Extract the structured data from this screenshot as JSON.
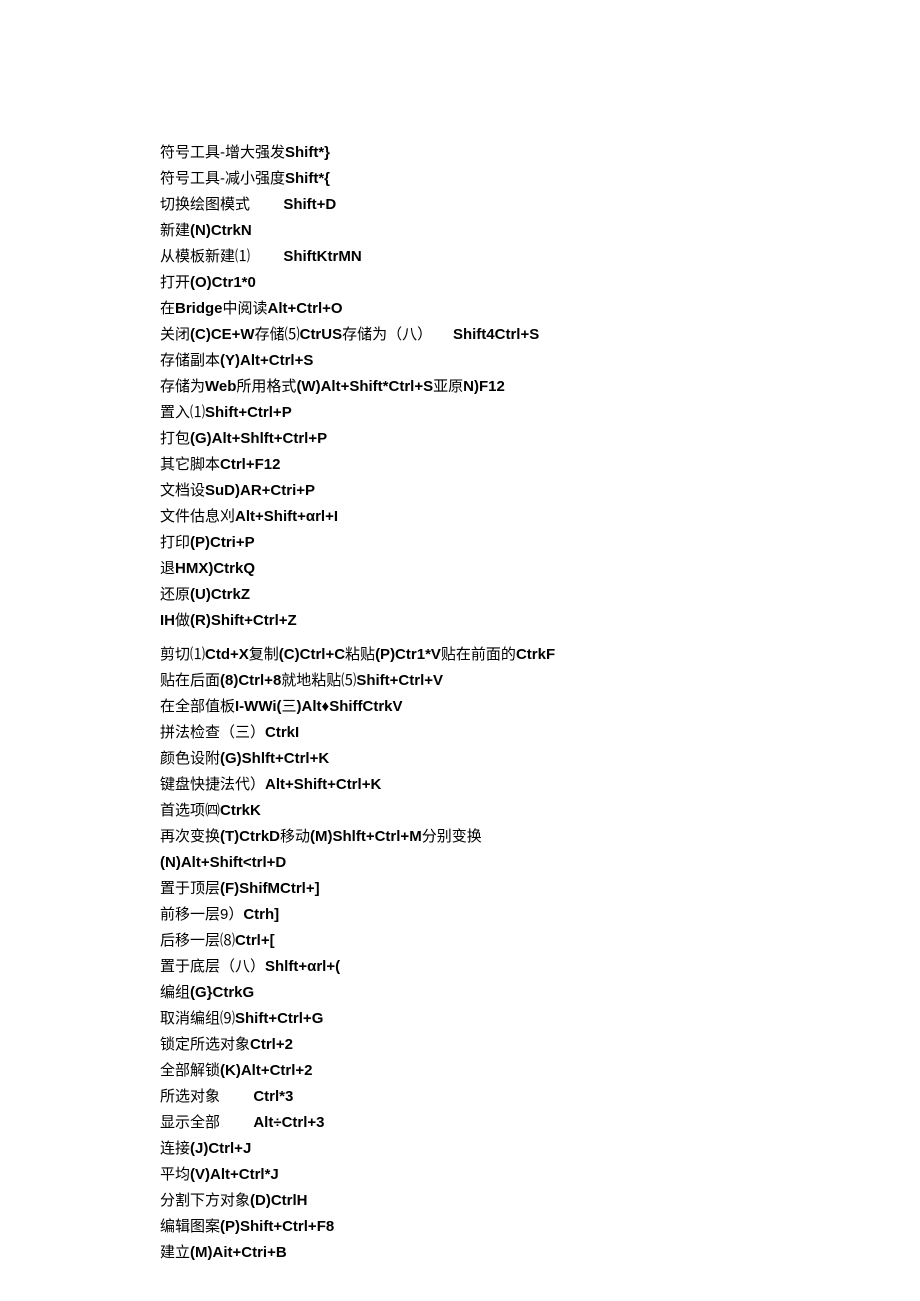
{
  "lines": [
    [
      {
        "t": "cn",
        "v": "符号工具-增大强发"
      },
      {
        "t": "en",
        "v": "Shift*}"
      }
    ],
    [
      {
        "t": "cn",
        "v": "符号工具-减小强度"
      },
      {
        "t": "en",
        "v": "Shift*{"
      }
    ],
    [
      {
        "t": "cn",
        "v": "切换绘图模式        "
      },
      {
        "t": "en",
        "v": "Shift+D"
      }
    ],
    [
      {
        "t": "cn",
        "v": "新建"
      },
      {
        "t": "en",
        "v": "(N)CtrkN"
      }
    ],
    [
      {
        "t": "cn",
        "v": "从模板新建⑴        "
      },
      {
        "t": "en",
        "v": "ShiftKtrMN"
      }
    ],
    [
      {
        "t": "cn",
        "v": "打开"
      },
      {
        "t": "en",
        "v": "(O)Ctr1*0"
      }
    ],
    [
      {
        "t": "cn",
        "v": "在"
      },
      {
        "t": "en",
        "v": "Bridge"
      },
      {
        "t": "cn",
        "v": "中阅读"
      },
      {
        "t": "en",
        "v": "Alt+Ctrl+O"
      }
    ],
    [
      {
        "t": "cn",
        "v": "关闭"
      },
      {
        "t": "en",
        "v": "(C)CE+W"
      },
      {
        "t": "cn",
        "v": "存储⑸"
      },
      {
        "t": "en",
        "v": "CtrUS"
      },
      {
        "t": "cn",
        "v": "存储为（八）     "
      },
      {
        "t": "en",
        "v": "Shift4Ctrl+S"
      }
    ],
    [
      {
        "t": "cn",
        "v": "存储副本"
      },
      {
        "t": "en",
        "v": "(Y)Alt+Ctrl+S"
      }
    ],
    [
      {
        "t": "cn",
        "v": "存储为"
      },
      {
        "t": "en",
        "v": "Web"
      },
      {
        "t": "cn",
        "v": "所用格式"
      },
      {
        "t": "en",
        "v": "(W)Alt+Shift*Ctrl+S"
      },
      {
        "t": "cn",
        "v": "亚原"
      },
      {
        "t": "en",
        "v": "N)F12"
      }
    ],
    [
      {
        "t": "cn",
        "v": "置入⑴"
      },
      {
        "t": "en",
        "v": "Shift+Ctrl+P"
      }
    ],
    [
      {
        "t": "cn",
        "v": "打包"
      },
      {
        "t": "en",
        "v": "(G)Alt+Shlft+Ctrl+P"
      }
    ],
    [
      {
        "t": "cn",
        "v": "其它脚本"
      },
      {
        "t": "en",
        "v": "Ctrl+F12"
      }
    ],
    [
      {
        "t": "cn",
        "v": "文档设"
      },
      {
        "t": "en",
        "v": "SuD)AR+Ctri+P"
      }
    ],
    [
      {
        "t": "cn",
        "v": "文件估息刈"
      },
      {
        "t": "en",
        "v": "Alt+Shift+αrl+I"
      }
    ],
    [
      {
        "t": "cn",
        "v": "打印"
      },
      {
        "t": "en",
        "v": "(P)Ctri+P"
      }
    ],
    [
      {
        "t": "cn",
        "v": "退"
      },
      {
        "t": "en",
        "v": "HMX)CtrkQ"
      }
    ],
    [
      {
        "t": "cn",
        "v": "还原"
      },
      {
        "t": "en",
        "v": "(U)CtrkZ"
      }
    ],
    [
      {
        "t": "en",
        "v": "IH"
      },
      {
        "t": "cn",
        "v": "做"
      },
      {
        "t": "en",
        "v": "(R)Shift+Ctrl+Z"
      }
    ],
    [
      {
        "t": "sp",
        "v": ""
      }
    ],
    [
      {
        "t": "cn",
        "v": "剪切⑴"
      },
      {
        "t": "en",
        "v": "Ctd+X"
      },
      {
        "t": "cn",
        "v": "复制"
      },
      {
        "t": "en",
        "v": "(C)Ctrl+C"
      },
      {
        "t": "cn",
        "v": "粘贴"
      },
      {
        "t": "en",
        "v": "(P)Ctr1*V"
      },
      {
        "t": "cn",
        "v": "贴在前面的"
      },
      {
        "t": "en",
        "v": "CtrkF"
      }
    ],
    [
      {
        "t": "cn",
        "v": "贴在后面"
      },
      {
        "t": "en",
        "v": "(8)Ctrl+8"
      },
      {
        "t": "cn",
        "v": "就地粘贴⑸"
      },
      {
        "t": "en",
        "v": "Shift+Ctrl+V"
      }
    ],
    [
      {
        "t": "cn",
        "v": "在全部值板"
      },
      {
        "t": "en",
        "v": "I-WWi("
      },
      {
        "t": "cn",
        "v": "三"
      },
      {
        "t": "en",
        "v": ")Alt♦ShiffCtrkV"
      }
    ],
    [
      {
        "t": "cn",
        "v": "拼法检查（三）"
      },
      {
        "t": "en",
        "v": "CtrkI"
      }
    ],
    [
      {
        "t": "cn",
        "v": "颜色设附"
      },
      {
        "t": "en",
        "v": "(G)Shlft+Ctrl+K"
      }
    ],
    [
      {
        "t": "cn",
        "v": "键盘快捷法代）"
      },
      {
        "t": "en",
        "v": "Alt+Shift+Ctrl+K"
      }
    ],
    [
      {
        "t": "cn",
        "v": "首选项㈣"
      },
      {
        "t": "en",
        "v": "CtrkK"
      }
    ],
    [
      {
        "t": "cn",
        "v": "再次变换"
      },
      {
        "t": "en",
        "v": "(T)CtrkD"
      },
      {
        "t": "cn",
        "v": "移动"
      },
      {
        "t": "en",
        "v": "(M)Shlft+Ctrl+M"
      },
      {
        "t": "cn",
        "v": "分别变换"
      }
    ],
    [
      {
        "t": "en",
        "v": "(N)Alt+Shift<trl+D"
      }
    ],
    [
      {
        "t": "cn",
        "v": "置于顶层"
      },
      {
        "t": "en",
        "v": "(F)ShifMCtrl+]"
      }
    ],
    [
      {
        "t": "cn",
        "v": "前移一层9）"
      },
      {
        "t": "en",
        "v": "Ctrh]"
      }
    ],
    [
      {
        "t": "cn",
        "v": "后移一层⑻"
      },
      {
        "t": "en",
        "v": "Ctrl+["
      }
    ],
    [
      {
        "t": "cn",
        "v": "置于底层（八）"
      },
      {
        "t": "en",
        "v": "Shlft+αrl+("
      }
    ],
    [
      {
        "t": "cn",
        "v": "编组"
      },
      {
        "t": "en",
        "v": "(G}CtrkG"
      }
    ],
    [
      {
        "t": "cn",
        "v": "取消编组⑼"
      },
      {
        "t": "en",
        "v": "Shift+Ctrl+G"
      }
    ],
    [
      {
        "t": "cn",
        "v": "锁定所选对象"
      },
      {
        "t": "en",
        "v": "Ctrl+2"
      }
    ],
    [
      {
        "t": "cn",
        "v": "全部解锁"
      },
      {
        "t": "en",
        "v": "(K)Alt+Ctrl+2"
      }
    ],
    [
      {
        "t": "cn",
        "v": "所选对象        "
      },
      {
        "t": "en",
        "v": "Ctrl*3"
      }
    ],
    [
      {
        "t": "cn",
        "v": "显示全部        "
      },
      {
        "t": "en",
        "v": "Alt÷Ctrl+3"
      }
    ],
    [
      {
        "t": "cn",
        "v": "连接"
      },
      {
        "t": "en",
        "v": "(J)Ctrl+J"
      }
    ],
    [
      {
        "t": "cn",
        "v": "平均"
      },
      {
        "t": "en",
        "v": "(V)Alt+Ctrl*J"
      }
    ],
    [
      {
        "t": "cn",
        "v": "分割下方对象"
      },
      {
        "t": "en",
        "v": "(D)CtrlH"
      }
    ],
    [
      {
        "t": "cn",
        "v": "编辑图案"
      },
      {
        "t": "en",
        "v": "(P)Shift+Ctrl+F8"
      }
    ],
    [
      {
        "t": "cn",
        "v": "建立"
      },
      {
        "t": "en",
        "v": "(M)Ait+Ctri+B"
      }
    ]
  ]
}
